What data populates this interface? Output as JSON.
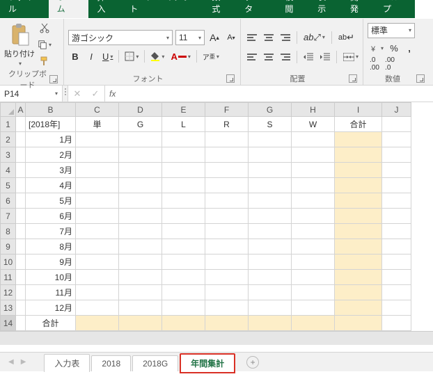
{
  "menu": {
    "file": "ファイル",
    "home": "ホーム",
    "insert": "挿入",
    "pagelayout": "ページ レイアウト",
    "formulas": "数式",
    "data": "データ",
    "review": "校閲",
    "view": "表示",
    "developer": "開発",
    "help": "ヘルプ"
  },
  "ribbon": {
    "clipboard": {
      "paste": "貼り付け",
      "group": "クリップボード"
    },
    "font": {
      "name": "游ゴシック",
      "size": "11",
      "group": "フォント",
      "bold": "B",
      "italic": "I",
      "underline": "U"
    },
    "align": {
      "group": "配置"
    },
    "number": {
      "format": "標準",
      "group": "数値"
    }
  },
  "namebox": "P14",
  "fx": "fx",
  "columns": [
    "A",
    "B",
    "C",
    "D",
    "E",
    "F",
    "G",
    "H",
    "I",
    "J"
  ],
  "rows": [
    "1",
    "2",
    "3",
    "4",
    "5",
    "6",
    "7",
    "8",
    "9",
    "10",
    "11",
    "12",
    "13",
    "14"
  ],
  "sheet": {
    "b1": "[2018年]",
    "headers": [
      "単",
      "G",
      "L",
      "R",
      "S",
      "W",
      "合計"
    ],
    "months": [
      "1月",
      "2月",
      "3月",
      "4月",
      "5月",
      "6月",
      "7月",
      "8月",
      "9月",
      "10月",
      "11月",
      "12月"
    ],
    "total": "合計"
  },
  "tabs": {
    "t1": "入力表",
    "t2": "2018",
    "t3": "2018G",
    "t4": "年間集計"
  }
}
